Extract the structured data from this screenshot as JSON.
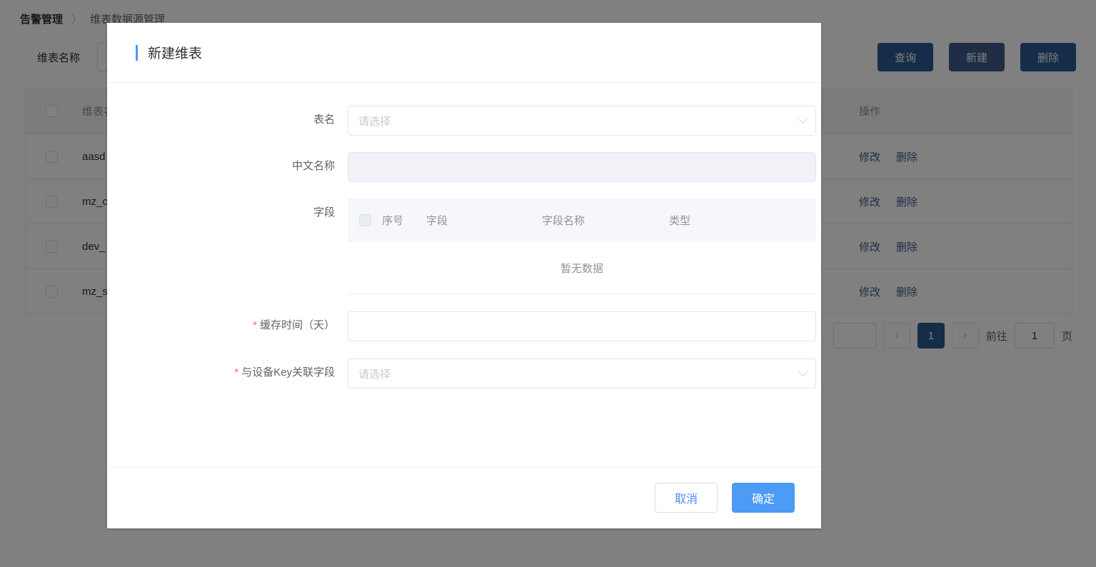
{
  "breadcrumb": {
    "root": "告警管理",
    "separator": "〉",
    "current": "维表数据源管理"
  },
  "filter": {
    "label": "维表名称",
    "value": ""
  },
  "toolbar": {
    "query_label": "查询",
    "create_label": "新建",
    "delete_label": "删除"
  },
  "table": {
    "columns": {
      "name": "维表名称",
      "operation": "操作"
    },
    "row_actions": {
      "edit": "修改",
      "delete": "删除"
    },
    "rows": [
      {
        "name": "aasd"
      },
      {
        "name": "mz_c"
      },
      {
        "name": "dev_"
      },
      {
        "name": "mz_s"
      }
    ]
  },
  "pagination": {
    "prev_icon": "‹",
    "next_icon": "›",
    "current_page": "1",
    "jump_prefix": "前往",
    "jump_value": "1",
    "jump_suffix": "页"
  },
  "modal": {
    "title": "新建维表",
    "fields": {
      "table_name": {
        "label": "表名",
        "placeholder": "请选择",
        "value": "",
        "required": false
      },
      "chinese_name": {
        "label": "中文名称",
        "placeholder": "",
        "value": "",
        "required": false,
        "disabled": true
      },
      "columns": {
        "label": "字段",
        "headers": {
          "index": "序号",
          "field": "字段",
          "field_name": "字段名称",
          "type": "类型"
        },
        "empty_text": "暂无数据",
        "rows": []
      },
      "cache_days": {
        "label": "缓存时间（天）",
        "required_mark": "*",
        "value": "",
        "placeholder": "",
        "required": true
      },
      "device_key": {
        "label": "与设备Key关联字段",
        "required_mark": "*",
        "placeholder": "请选择",
        "value": "",
        "required": true
      }
    },
    "footer": {
      "cancel_label": "取消",
      "confirm_label": "确定"
    }
  },
  "icons": {
    "chevron_down": "chevron-down-icon"
  },
  "colors": {
    "primary_blue": "#4c9bf5",
    "dark_blue": "#2b5a92",
    "required_red": "#f56c6c",
    "link_blue": "#3f5c8c"
  }
}
